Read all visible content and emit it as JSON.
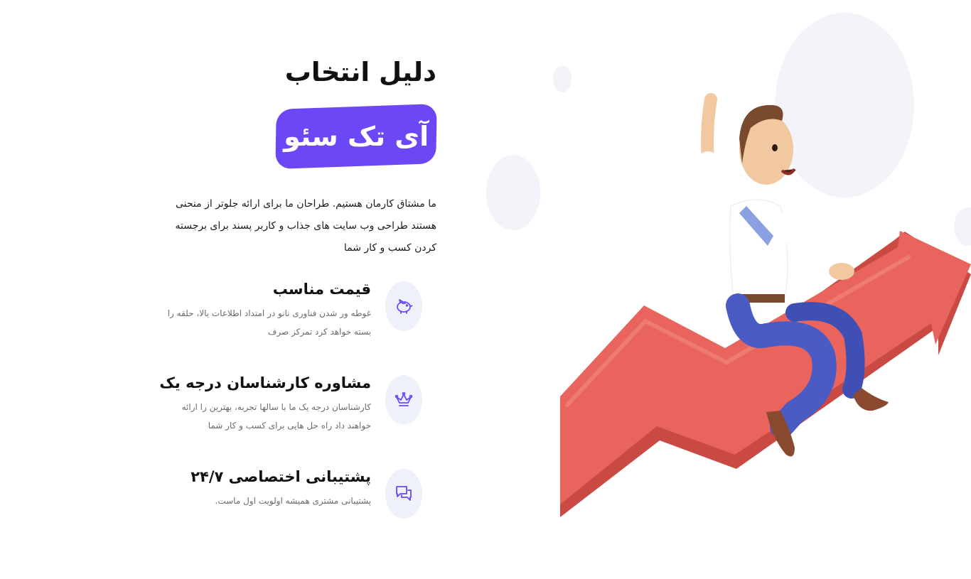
{
  "hero": {
    "heading": "دلیل انتخاب",
    "brand": "آی تک سئو",
    "intro": "ما مشتاق کارمان هستیم. طراحان ما برای ارائه جلوتر از منحنی هستند طراحی وب سایت های جذاب و کاربر پسند برای برجسته کردن کسب و کار شما"
  },
  "features": [
    {
      "title": "قیمت مناسب",
      "description": "غوطه ور شدن فناوری نانو در امتداد اطلاعات بالا، حلقه را بسته خواهد کرد تمرکز صرف",
      "icon": "piggy-bank-icon"
    },
    {
      "title": "مشاوره کارشناسان درجه یک",
      "description": "کارشناسان درجه یک ما با سالها تجربه، بهترین را ارائه خواهند داد راه حل هایی برای کسب و کار شما",
      "icon": "crown-icon"
    },
    {
      "title": "پشتیبانی اختصاصی ۲۴/۷",
      "description": "پشتیبانی مشتری همیشه اولویت اول ماست.",
      "icon": "chat-bubbles-icon"
    }
  ],
  "colors": {
    "accent": "#6c47f5",
    "arrow": "#e8645c",
    "icon_background": "#eef1f9",
    "heading_text": "#111111",
    "body_text": "#6b6b6b"
  }
}
